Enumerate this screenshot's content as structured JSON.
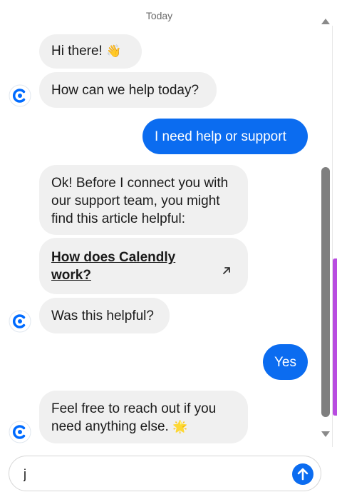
{
  "date_separator": "Today",
  "messages": {
    "greeting": "Hi there!",
    "greeting_emoji": "👋",
    "help_question": "How can we help today?",
    "user_request": "I need help or support",
    "bot_intro": "Ok! Before I connect you with our support team, you might find this article helpful:",
    "article_title": "How does Calendly work?",
    "helpful_question": "Was this helpful?",
    "user_answer": "Yes",
    "closing": "Feel free to reach out if you need anything else.",
    "closing_emoji": "🌟"
  },
  "composer": {
    "value": "j",
    "placeholder": ""
  },
  "colors": {
    "user_bubble": "#0b6cf0",
    "bot_bubble": "#f0f0f0",
    "accent": "#0b6cf0",
    "scroll_thumb": "#7f7f7f",
    "edge_accent": "#b84ce0"
  },
  "icons": {
    "avatar": "calendly-logo-icon",
    "external_link": "external-link-arrow-icon",
    "send": "arrow-up-icon"
  }
}
